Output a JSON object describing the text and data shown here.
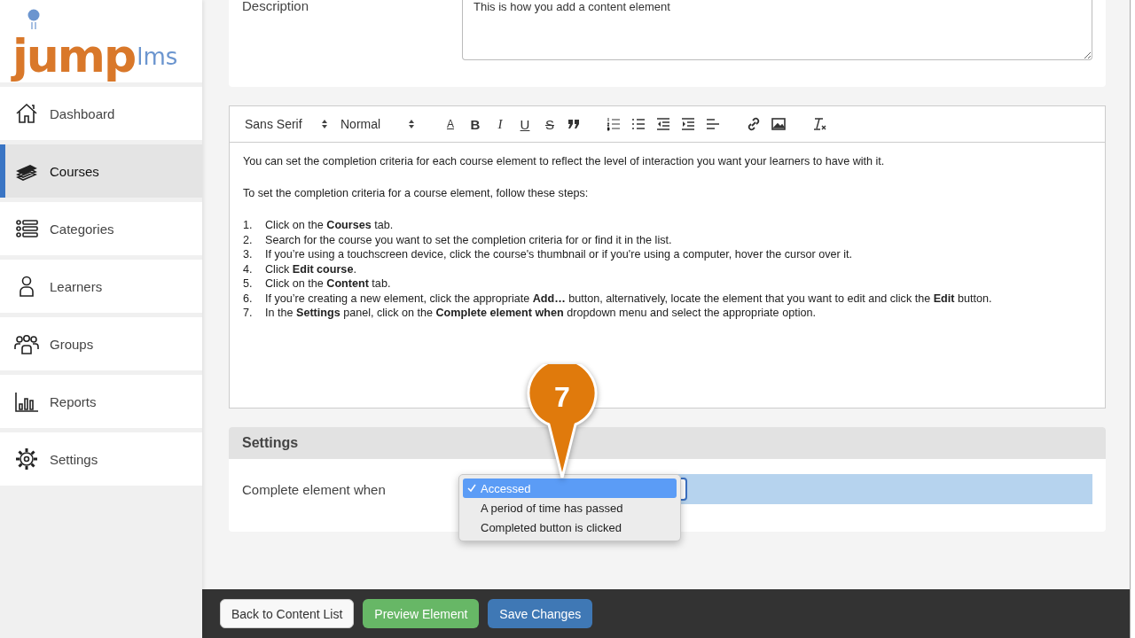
{
  "logo": {
    "word": "jump",
    "suffix": "lms"
  },
  "sidebar": {
    "items": [
      {
        "label": "Dashboard",
        "selected": false
      },
      {
        "label": "Courses",
        "selected": true
      },
      {
        "label": "Categories",
        "selected": false
      },
      {
        "label": "Learners",
        "selected": false
      },
      {
        "label": "Groups",
        "selected": false
      },
      {
        "label": "Reports",
        "selected": false
      },
      {
        "label": "Settings",
        "selected": false
      }
    ]
  },
  "description": {
    "label": "Description",
    "value": "This is how you add a content element"
  },
  "editor": {
    "toolbar": {
      "font": "Sans Serif",
      "size": "Normal",
      "glyph_buttons": [
        "A",
        "B",
        "I",
        "U",
        "S"
      ]
    },
    "paragraphs": [
      "You can set the completion criteria for each course element to reflect the level of interaction you want your learners to have with it.",
      "To set the completion criteria for a course element, follow these steps:"
    ],
    "steps": [
      {
        "number": "1.",
        "text": "Click on the **Courses** tab."
      },
      {
        "number": "2.",
        "text": "Search for the course you want to set the completion criteria for or find it in the list."
      },
      {
        "number": "3.",
        "text": "If you’re using a touchscreen device, click the course's thumbnail or if you're using a computer, hover the cursor over it."
      },
      {
        "number": "4.",
        "text": "Click **Edit course**."
      },
      {
        "number": "5.",
        "text": "Click on the **Content** tab."
      },
      {
        "number": "6.",
        "text": "If you’re creating a new element, click the appropriate **Add…** button, alternatively, locate the element that you want to edit and click the **Edit** button."
      },
      {
        "number": "7.",
        "text": "In the **Settings** panel, click on the **Complete element when** dropdown menu and select the appropriate option."
      }
    ]
  },
  "settings": {
    "title": "Settings",
    "field_label": "Complete element when",
    "options": [
      {
        "label": "Accessed",
        "selected": true
      },
      {
        "label": "A period of time has passed",
        "selected": false
      },
      {
        "label": "Completed button is clicked",
        "selected": false
      }
    ]
  },
  "callout": {
    "number": "7"
  },
  "footer": {
    "buttons": [
      {
        "label": "Back to Content List",
        "kind": "secondary"
      },
      {
        "label": "Preview Element",
        "kind": "success"
      },
      {
        "label": "Save Changes",
        "kind": "primary"
      }
    ]
  }
}
